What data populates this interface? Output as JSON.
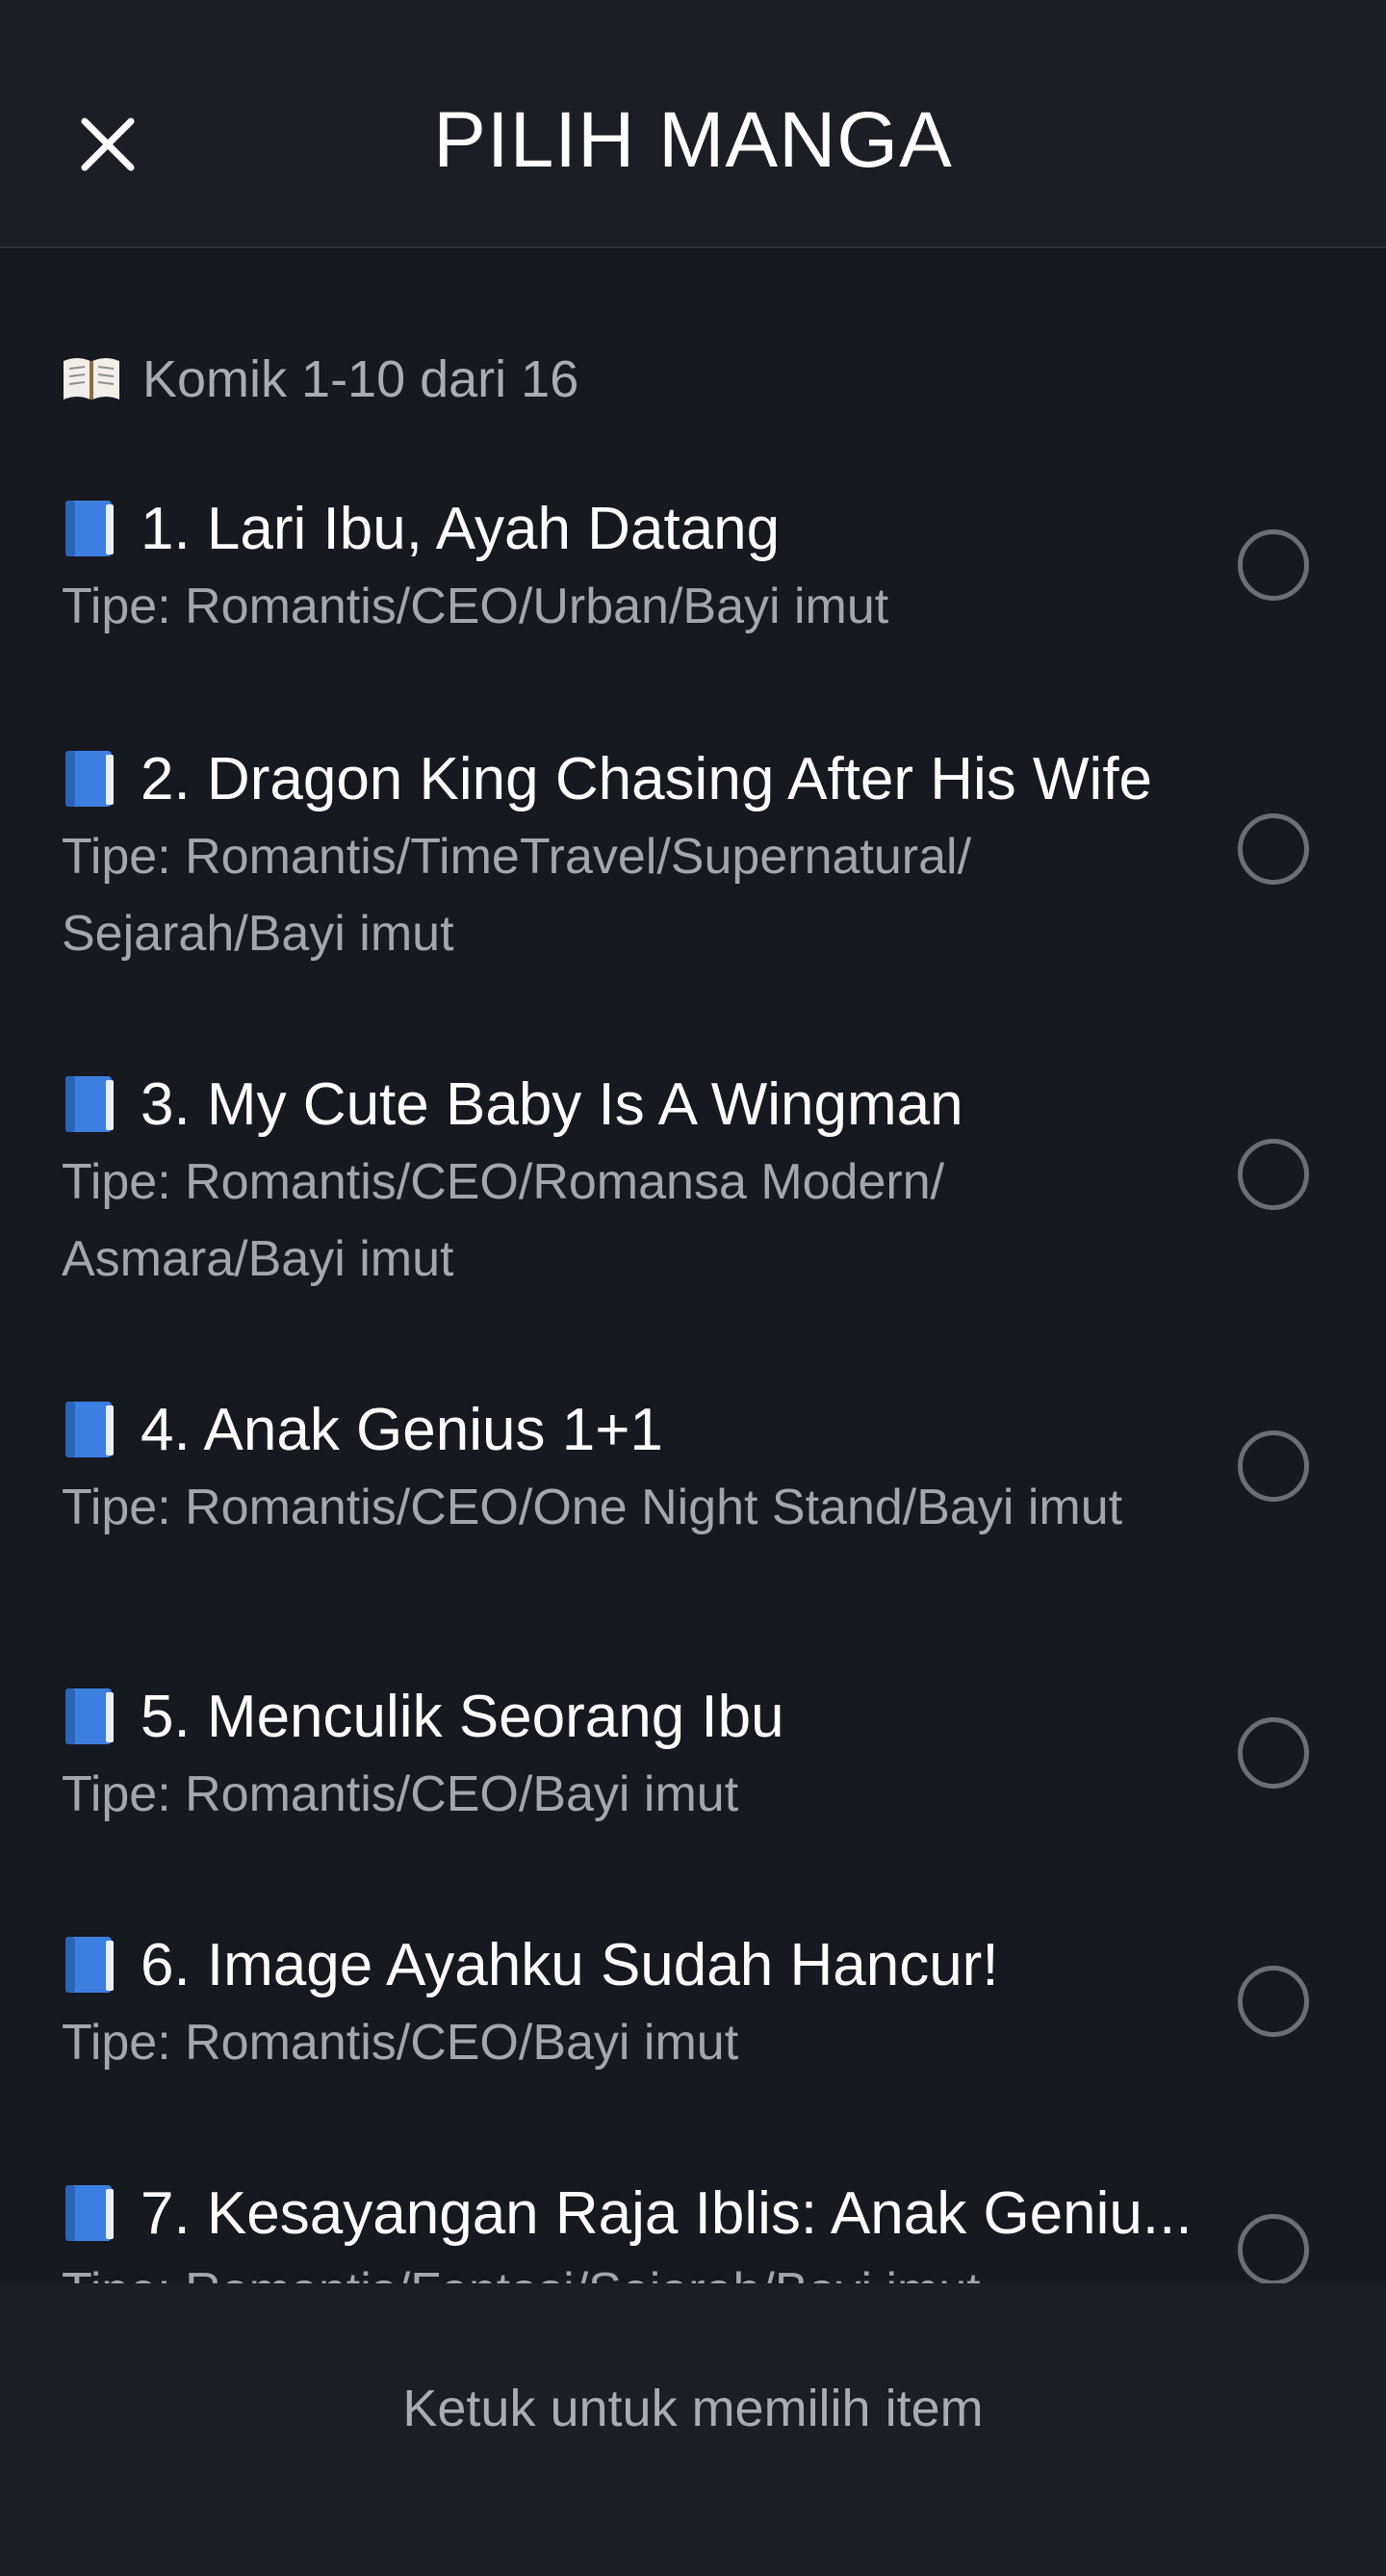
{
  "header": {
    "title": "PILIH MANGA",
    "close_icon": "close-icon"
  },
  "subheader": {
    "icon": "open-book-icon",
    "text": "Komik 1-10 dari 16"
  },
  "list": {
    "item_icon": "blue-book-icon",
    "items": [
      {
        "title": "1. Lari Ibu, Ayah Datang",
        "genre": "Tipe: Romantis/CEO/Urban/Bayi imut",
        "selected": false
      },
      {
        "title": "2. Dragon King Chasing After His Wife",
        "genre": "Tipe: Romantis/TimeTravel/Supernatural/ Sejarah/Bayi imut",
        "selected": false
      },
      {
        "title": "3. My Cute Baby Is A Wingman",
        "genre": "Tipe: Romantis/CEO/Romansa Modern/ Asmara/Bayi imut",
        "selected": false
      },
      {
        "title": "4. Anak Genius 1+1",
        "genre": "Tipe: Romantis/CEO/One Night Stand/Bayi imut",
        "selected": false
      },
      {
        "title": "5. Menculik Seorang Ibu",
        "genre": "Tipe: Romantis/CEO/Bayi imut",
        "selected": false
      },
      {
        "title": "6. Image Ayahku Sudah Hancur!",
        "genre": "Tipe: Romantis/CEO/Bayi imut",
        "selected": false
      },
      {
        "title": "7. Kesayangan Raja Iblis: Anak Geniu...",
        "genre": "Tipe: Romantis/Fantasi/Sejarah/Bayi imut",
        "selected": false
      }
    ]
  },
  "footer": {
    "hint": "Ketuk untuk memilih item"
  },
  "colors": {
    "background": "#16191f",
    "header_background": "#1b1e24",
    "text_primary": "#ffffff",
    "text_secondary": "#a3a6ac",
    "radio_border": "#6b6e74",
    "book_blue": "#3d7fe0"
  }
}
